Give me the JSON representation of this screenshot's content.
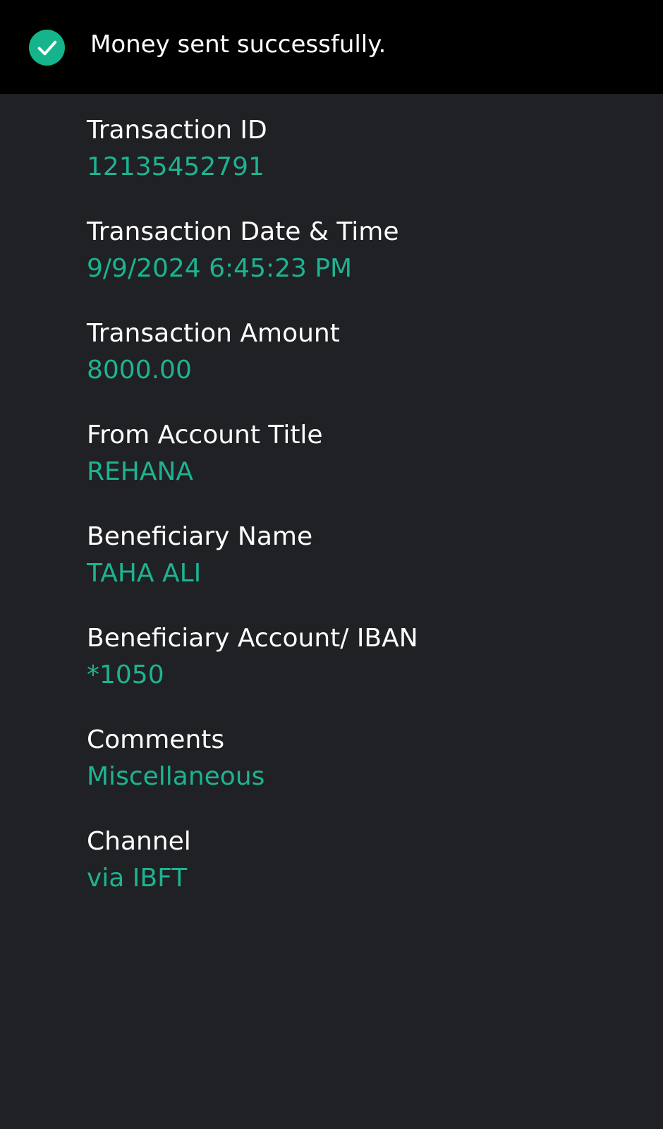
{
  "banner": {
    "icon": "check-circle-icon",
    "message": "Money sent successfully.",
    "background": "#000000",
    "icon_color": "#15b48c"
  },
  "colors": {
    "page_background": "#202124",
    "label": "#ffffff",
    "value": "#1db392"
  },
  "details": [
    {
      "label": "Transaction ID",
      "value": "12135452791"
    },
    {
      "label": "Transaction Date & Time",
      "value": "9/9/2024 6:45:23 PM"
    },
    {
      "label": "Transaction Amount",
      "value": "8000.00"
    },
    {
      "label": "From Account Title",
      "value": "REHANA"
    },
    {
      "label": "Beneficiary Name",
      "value": "TAHA ALI"
    },
    {
      "label": "Beneficiary Account/ IBAN",
      "value": "*1050"
    },
    {
      "label": "Comments",
      "value": "Miscellaneous"
    },
    {
      "label": "Channel",
      "value": "via IBFT"
    }
  ]
}
